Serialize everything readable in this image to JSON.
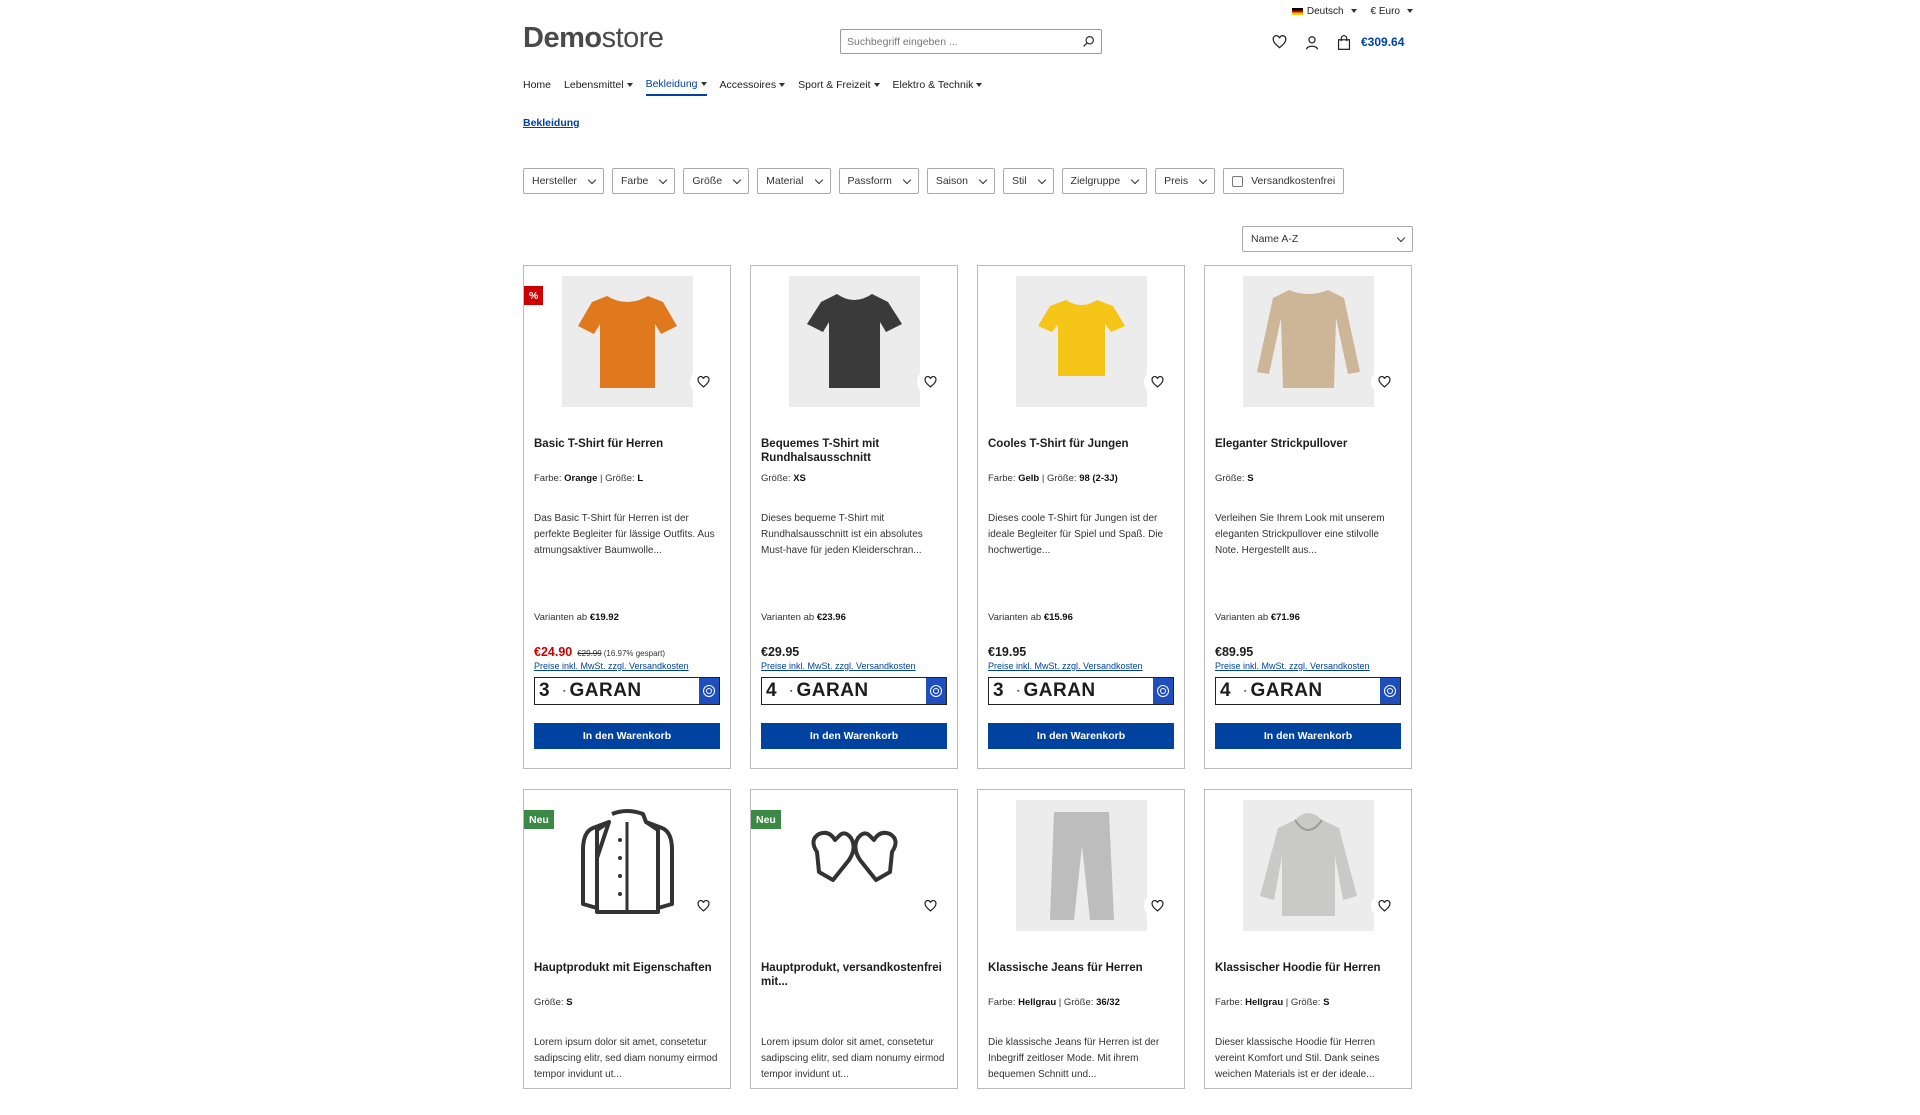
{
  "topbar": {
    "language": "Deutsch",
    "currency": "€ Euro"
  },
  "header": {
    "logo_bold": "Demo",
    "logo_light": "store",
    "search_placeholder": "Suchbegriff eingeben ...",
    "cart_total": "€309.64"
  },
  "nav": {
    "items": [
      {
        "label": "Home",
        "dropdown": false
      },
      {
        "label": "Lebensmittel",
        "dropdown": true
      },
      {
        "label": "Bekleidung",
        "dropdown": true,
        "active": true
      },
      {
        "label": "Accessoires",
        "dropdown": true
      },
      {
        "label": "Sport & Freizeit",
        "dropdown": true
      },
      {
        "label": "Elektro & Technik",
        "dropdown": true
      }
    ]
  },
  "breadcrumb": "Bekleidung",
  "filters": [
    "Hersteller",
    "Farbe",
    "Größe",
    "Material",
    "Passform",
    "Saison",
    "Stil",
    "Zielgruppe",
    "Preis"
  ],
  "filter_checkbox": "Versandkostenfrei",
  "sort": "Name A-Z",
  "products": [
    {
      "badge": "%",
      "title": "Basic T-Shirt für Herren",
      "props": [
        {
          "k": "Farbe:",
          "v": "Orange"
        },
        {
          "k": "Größe:",
          "v": "L"
        }
      ],
      "description": "Das Basic T-Shirt für Herren ist der perfekte Begleiter für lässige Outfits. Aus atmungsaktiver Baumwolle...",
      "variants_label": "Varianten ab",
      "variants_price": "€19.92",
      "price": "€24.90",
      "old_price": "€29.99",
      "saved": "(16.97% gespart)",
      "vat": "Preise inkl. MwSt. zzgl. Versandkosten",
      "garant_num": "3",
      "garant_word": "GARAN",
      "button": "In den Warenkorb",
      "image_color": "#e0781d"
    },
    {
      "badge": "",
      "title": "Bequemes T-Shirt mit Rundhalsausschnitt",
      "props": [
        {
          "k": "Größe:",
          "v": "XS"
        }
      ],
      "description": "Dieses bequeme T-Shirt mit Rundhalsausschnitt ist ein absolutes Must-have für jeden Kleiderschran...",
      "variants_label": "Varianten ab",
      "variants_price": "€23.96",
      "price": "€29.95",
      "vat": "Preise inkl. MwSt. zzgl. Versandkosten",
      "garant_num": "4",
      "garant_word": "GARAN",
      "button": "In den Warenkorb",
      "image_color": "#3a3a3a"
    },
    {
      "badge": "",
      "title": "Cooles T-Shirt für Jungen",
      "props": [
        {
          "k": "Farbe:",
          "v": "Gelb"
        },
        {
          "k": "Größe:",
          "v": "98 (2-3J)"
        }
      ],
      "description": "Dieses coole T-Shirt für Jungen ist der ideale Begleiter für Spiel und Spaß. Die hochwertige...",
      "variants_label": "Varianten ab",
      "variants_price": "€15.96",
      "price": "€19.95",
      "vat": "Preise inkl. MwSt. zzgl. Versandkosten",
      "garant_num": "3",
      "garant_word": "GARAN",
      "button": "In den Warenkorb",
      "image_color": "#f5c518"
    },
    {
      "badge": "",
      "title": "Eleganter Strickpullover",
      "props": [
        {
          "k": "Größe:",
          "v": "S"
        }
      ],
      "description": "Verleihen Sie Ihrem Look mit unserem eleganten Strickpullover eine stilvolle Note. Hergestellt aus...",
      "variants_label": "Varianten ab",
      "variants_price": "€71.96",
      "price": "€89.95",
      "vat": "Preise inkl. MwSt. zzgl. Versandkosten",
      "garant_num": "4",
      "garant_word": "GARAN",
      "button": "In den Warenkorb",
      "image_color": "#cdb597"
    },
    {
      "badge": "Neu",
      "title": "Hauptprodukt mit Eigenschaften",
      "props": [
        {
          "k": "Größe:",
          "v": "S"
        }
      ],
      "description": "Lorem ipsum dolor sit amet, consetetur sadipscing elitr, sed diam nonumy eirmod tempor invidunt ut..."
    },
    {
      "badge": "Neu",
      "title": "Hauptprodukt, versandkostenfrei mit...",
      "props": [],
      "description": "Lorem ipsum dolor sit amet, consetetur sadipscing elitr, sed diam nonumy eirmod tempor invidunt ut..."
    },
    {
      "badge": "",
      "title": "Klassische Jeans für Herren",
      "props": [
        {
          "k": "Farbe:",
          "v": "Hellgrau"
        },
        {
          "k": "Größe:",
          "v": "36/32"
        }
      ],
      "description": "Die klassische Jeans für Herren ist der Inbegriff zeitloser Mode. Mit ihrem bequemen Schnitt und...",
      "image_color": "#bdbdbd"
    },
    {
      "badge": "",
      "title": "Klassischer Hoodie für Herren",
      "props": [
        {
          "k": "Farbe:",
          "v": "Hellgrau"
        },
        {
          "k": "Größe:",
          "v": "S"
        }
      ],
      "description": "Dieser klassische Hoodie für Herren vereint Komfort und Stil. Dank seines weichen Materials ist er der ideale...",
      "image_color": "#c9c9c7"
    }
  ],
  "colors": {
    "brand_blue": "#0042a0",
    "sale_red": "#cc0000",
    "new_green": "#3a8a45"
  }
}
